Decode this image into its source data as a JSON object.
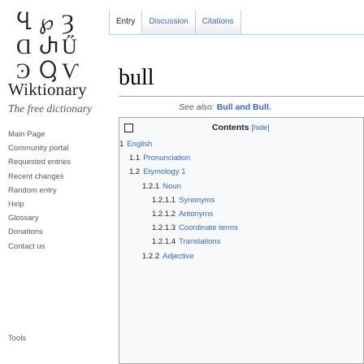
{
  "logo": {
    "wordmark": "Wiktionary",
    "tagline": "The free dictionary",
    "glyphs": [
      "Ⴁ",
      "℘",
      "Ȝ",
      "Ɑ",
      "Ⴐ",
      "Ű",
      "Ͽ",
      "Ⴓ",
      "Ѵ"
    ]
  },
  "sidebar": {
    "items": [
      "Main Page",
      "Community portal",
      "Requested entries",
      "Recent changes",
      "Random entry",
      "Help",
      "Glossary",
      "Donations",
      "Contact us"
    ],
    "tools_label": "Tools"
  },
  "tabs": [
    {
      "label": "Entry",
      "selected": true
    },
    {
      "label": "Discussion",
      "selected": false
    },
    {
      "label": "Citations",
      "selected": false
    }
  ],
  "page": {
    "title": "bull",
    "see_also_lead": "See also:",
    "see_also_link": "Bull and Bull."
  },
  "toc": {
    "heading": "Contents",
    "hide_label": "[hide]",
    "items": [
      {
        "num": "1",
        "label": "English",
        "level": 1
      },
      {
        "num": "1.1",
        "label": "Pronunciation",
        "level": 2
      },
      {
        "num": "1.2",
        "label": "Etymology 1",
        "level": 2
      },
      {
        "num": "1.2.1",
        "label": "Noun",
        "level": 3
      },
      {
        "num": "1.2.1.1",
        "label": "Synonyms",
        "level": 4
      },
      {
        "num": "1.2.1.2",
        "label": "Antonyms",
        "level": 4
      },
      {
        "num": "1.2.1.3",
        "label": "Coordinate terms",
        "level": 4
      },
      {
        "num": "1.2.1.4",
        "label": "Translations",
        "level": 4
      },
      {
        "num": "1.2.2",
        "label": "Adjective",
        "level": 3
      }
    ]
  }
}
